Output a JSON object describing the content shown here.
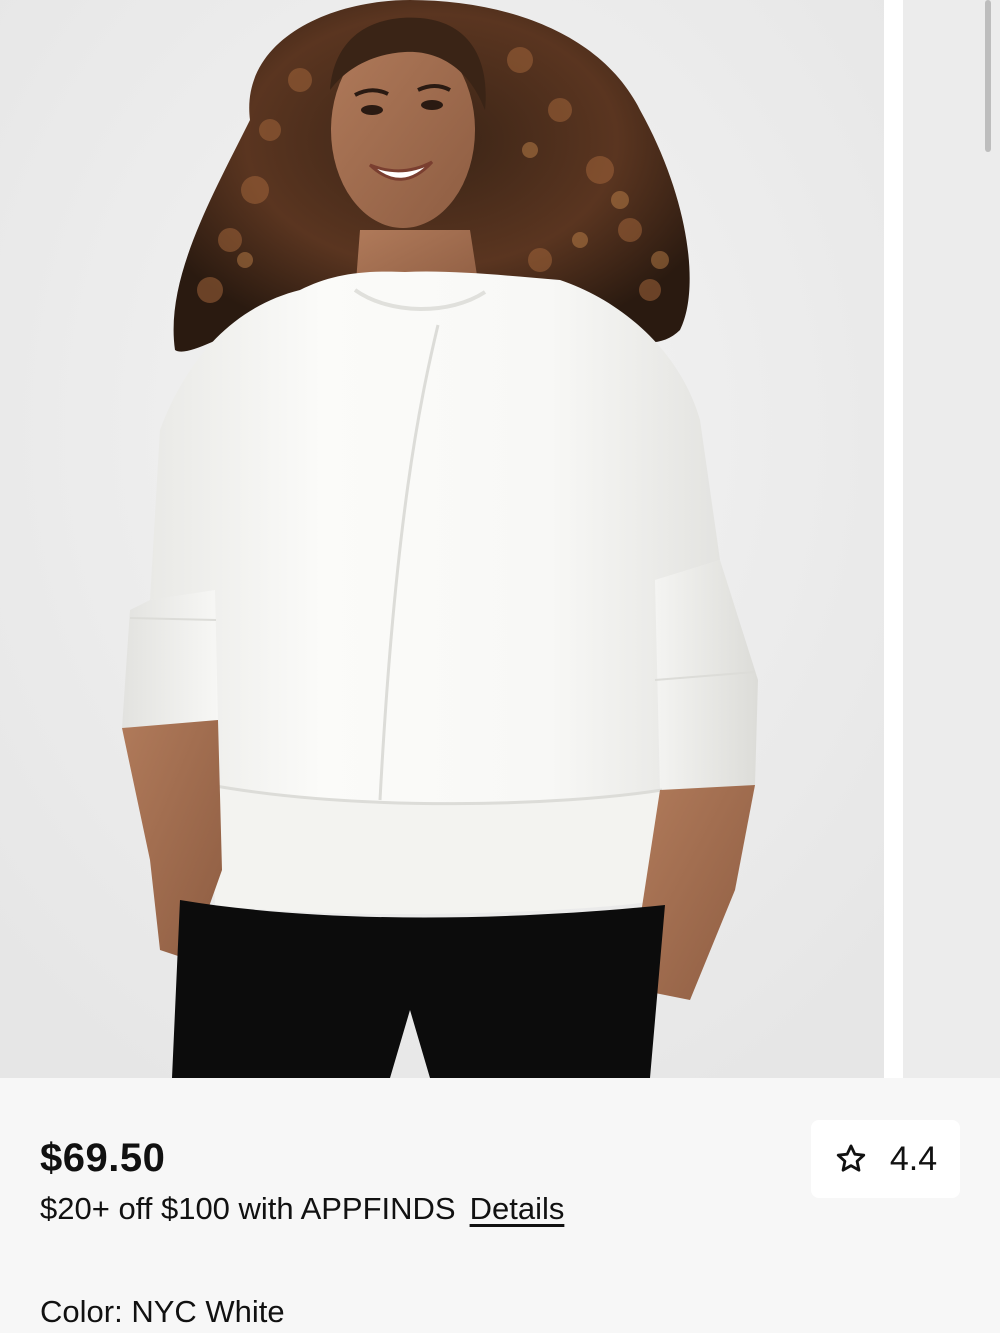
{
  "product": {
    "price": "$69.50",
    "promo_text": "$20+ off $100 with APPFINDS",
    "promo_link": "Details",
    "color_label": "Color:",
    "color_value": "NYC White",
    "rating": "4.4",
    "rating_icon": "star-outline-icon"
  },
  "colors": {
    "text": "#111111",
    "panel_bg": "#f7f7f7",
    "photo_bg": "#efefef",
    "top_color": "#f6f6f3",
    "pants_color": "#0c0c0c"
  }
}
